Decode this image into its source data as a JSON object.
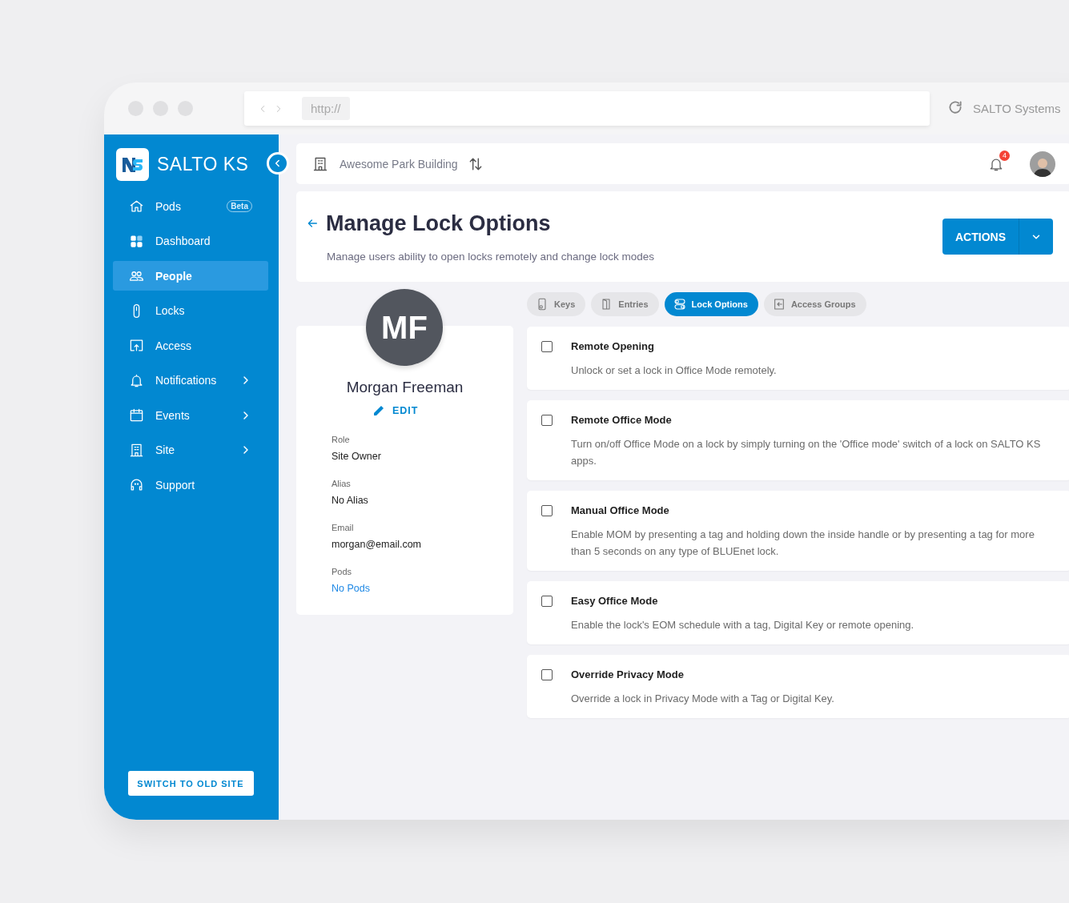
{
  "browser": {
    "url": "http://",
    "title": "SALTO Systems"
  },
  "sidebar": {
    "brand": "SALTO KS",
    "items": [
      {
        "label": "Pods",
        "badge": "Beta",
        "selected": false,
        "expandable": false
      },
      {
        "label": "Dashboard",
        "selected": false,
        "expandable": false
      },
      {
        "label": "People",
        "selected": true,
        "expandable": false
      },
      {
        "label": "Locks",
        "selected": false,
        "expandable": false
      },
      {
        "label": "Access",
        "selected": false,
        "expandable": false
      },
      {
        "label": "Notifications",
        "selected": false,
        "expandable": true
      },
      {
        "label": "Events",
        "selected": false,
        "expandable": true
      },
      {
        "label": "Site",
        "selected": false,
        "expandable": true
      },
      {
        "label": "Support",
        "selected": false,
        "expandable": false
      }
    ],
    "switch_button": "SWITCH TO OLD SITE"
  },
  "topbar": {
    "site": "Awesome Park Building",
    "notification_count": "4"
  },
  "header": {
    "title": "Manage Lock Options",
    "subtitle": "Manage users ability to open locks remotely and change lock modes",
    "actions": "ACTIONS"
  },
  "profile": {
    "initials": "MF",
    "name": "Morgan Freeman",
    "edit": "EDIT",
    "fields": [
      {
        "label": "Role",
        "value": "Site Owner",
        "kind": "text"
      },
      {
        "label": "Alias",
        "value": "No Alias",
        "kind": "text"
      },
      {
        "label": "Email",
        "value": "morgan@email.com",
        "kind": "text"
      },
      {
        "label": "Pods",
        "value": "No Pods",
        "kind": "link"
      }
    ]
  },
  "tabs": [
    {
      "label": "Keys",
      "selected": false
    },
    {
      "label": "Entries",
      "selected": false
    },
    {
      "label": "Lock Options",
      "selected": true
    },
    {
      "label": "Access Groups",
      "selected": false
    }
  ],
  "options": [
    {
      "title": "Remote Opening",
      "description": "Unlock or set a lock in Office Mode remotely.",
      "checked": false
    },
    {
      "title": "Remote Office Mode",
      "description": "Turn on/off Office Mode on a lock by simply turning on the 'Office mode' switch of a lock on SALTO KS apps.",
      "checked": false
    },
    {
      "title": "Manual Office Mode",
      "description": "Enable MOM by presenting a tag and holding down the inside handle or by presenting a tag for more than 5 seconds on any type of BLUEnet lock.",
      "checked": false
    },
    {
      "title": "Easy Office Mode",
      "description": "Enable the lock's EOM schedule with a tag, Digital Key or remote opening.",
      "checked": false
    },
    {
      "title": "Override Privacy Mode",
      "description": "Override a lock in Privacy Mode with a Tag or Digital Key.",
      "checked": false
    }
  ]
}
